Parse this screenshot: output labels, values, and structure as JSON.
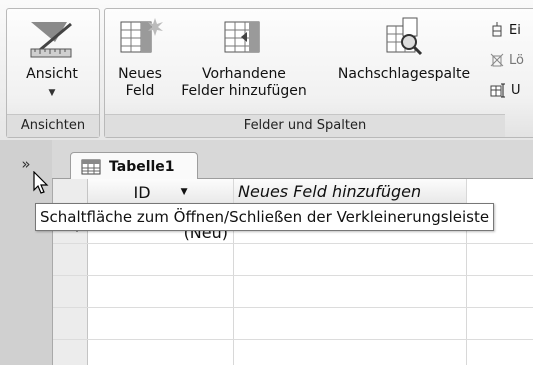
{
  "ribbon": {
    "groups": {
      "ansichten": {
        "label": "Ansichten"
      },
      "felder": {
        "label": "Felder und Spalten"
      }
    },
    "buttons": {
      "ansicht": {
        "label": "Ansicht",
        "icon": "design-view-icon"
      },
      "neues_feld": {
        "line1": "Neues",
        "line2": "Feld",
        "icon": "new-field-icon"
      },
      "vorhandene": {
        "line1": "Vorhandene",
        "line2": "Felder hinzufügen",
        "icon": "existing-fields-icon"
      },
      "nachschlage": {
        "label": "Nachschlagespalte",
        "icon": "lookup-column-icon"
      }
    },
    "small_buttons": [
      {
        "label": "Ei",
        "icon": "insert-column-icon"
      },
      {
        "label": "Lö",
        "icon": "delete-column-icon"
      },
      {
        "label": "U",
        "icon": "rename-column-icon"
      }
    ]
  },
  "nav": {
    "toggle": "»"
  },
  "document_tab": {
    "label": "Tabelle1",
    "icon": "table-icon"
  },
  "datasheet": {
    "columns": [
      {
        "header": "ID"
      },
      {
        "header": "Neues Feld hinzufügen"
      }
    ],
    "new_row": {
      "marker": "*",
      "value": "(Neu)"
    }
  },
  "tooltip": {
    "text": "Schaltfläche zum Öffnen/Schließen der Verkleinerungsleiste"
  },
  "colors": {
    "ribbon_bg": "#e6e6e6",
    "group_label_bg": "#dedede",
    "tab_bg": "#fafafa"
  }
}
